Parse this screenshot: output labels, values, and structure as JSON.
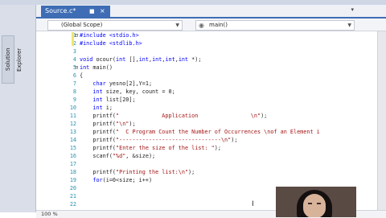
{
  "tab": {
    "title": "Source.c*"
  },
  "side_panel": {
    "label": "Solution Explorer"
  },
  "nav": {
    "scope": "(Global Scope)",
    "function": "main()"
  },
  "code_lines": [
    {
      "n": "1",
      "parts": [
        {
          "t": "#include <stdio.h>",
          "c": "kw"
        }
      ]
    },
    {
      "n": "2",
      "parts": [
        {
          "t": "#include <stdlib.h>",
          "c": "kw"
        }
      ]
    },
    {
      "n": "3",
      "parts": []
    },
    {
      "n": "4",
      "parts": [
        {
          "t": "void",
          "c": "kw"
        },
        {
          "t": " ocour(",
          "c": ""
        },
        {
          "t": "int",
          "c": "kw"
        },
        {
          "t": " [],",
          "c": ""
        },
        {
          "t": "int",
          "c": "kw"
        },
        {
          "t": ",",
          "c": ""
        },
        {
          "t": "int",
          "c": "kw"
        },
        {
          "t": ",",
          "c": ""
        },
        {
          "t": "int",
          "c": "kw"
        },
        {
          "t": ",",
          "c": ""
        },
        {
          "t": "int",
          "c": "kw"
        },
        {
          "t": " *);",
          "c": ""
        }
      ]
    },
    {
      "n": "5",
      "parts": [
        {
          "t": "int",
          "c": "kw"
        },
        {
          "t": " main()",
          "c": ""
        }
      ]
    },
    {
      "n": "6",
      "parts": [
        {
          "t": "{",
          "c": ""
        }
      ]
    },
    {
      "n": "7",
      "parts": [
        {
          "t": "    ",
          "c": ""
        },
        {
          "t": "char",
          "c": "kw"
        },
        {
          "t": " yesno[2],Y=1;",
          "c": ""
        }
      ]
    },
    {
      "n": "8",
      "parts": [
        {
          "t": "    ",
          "c": ""
        },
        {
          "t": "int",
          "c": "kw"
        },
        {
          "t": " size, key, count = 0;",
          "c": ""
        }
      ]
    },
    {
      "n": "9",
      "parts": [
        {
          "t": "    ",
          "c": ""
        },
        {
          "t": "int",
          "c": "kw"
        },
        {
          "t": " list[20];",
          "c": ""
        }
      ]
    },
    {
      "n": "10",
      "parts": [
        {
          "t": "    ",
          "c": ""
        },
        {
          "t": "int",
          "c": "kw"
        },
        {
          "t": " i;",
          "c": ""
        }
      ]
    },
    {
      "n": "11",
      "parts": [
        {
          "t": "    printf(",
          "c": ""
        },
        {
          "t": "\"             Application                \\n\"",
          "c": "str"
        },
        {
          "t": ");",
          "c": ""
        }
      ]
    },
    {
      "n": "12",
      "parts": [
        {
          "t": "    printf(",
          "c": ""
        },
        {
          "t": "\"\\n\"",
          "c": "str"
        },
        {
          "t": ");",
          "c": ""
        }
      ]
    },
    {
      "n": "13",
      "parts": [
        {
          "t": "    printf(",
          "c": ""
        },
        {
          "t": "\"  C Program Count the Number of Occurrences \\nof an Element i",
          "c": "str"
        }
      ]
    },
    {
      "n": "14",
      "parts": [
        {
          "t": "    printf(",
          "c": ""
        },
        {
          "t": "\"-------------------------------\\n\"",
          "c": "str"
        },
        {
          "t": ");",
          "c": ""
        }
      ]
    },
    {
      "n": "15",
      "parts": [
        {
          "t": "    printf(",
          "c": ""
        },
        {
          "t": "\"Enter the size of the list: \"",
          "c": "str"
        },
        {
          "t": ");",
          "c": ""
        }
      ]
    },
    {
      "n": "16",
      "parts": [
        {
          "t": "    scanf(",
          "c": ""
        },
        {
          "t": "\"%d\"",
          "c": "str"
        },
        {
          "t": ", &size);",
          "c": ""
        }
      ]
    },
    {
      "n": "17",
      "parts": []
    },
    {
      "n": "18",
      "parts": [
        {
          "t": "    printf(",
          "c": ""
        },
        {
          "t": "\"Printing the list:\\n\"",
          "c": "str"
        },
        {
          "t": ");",
          "c": ""
        }
      ]
    },
    {
      "n": "19",
      "parts": [
        {
          "t": "    ",
          "c": ""
        },
        {
          "t": "for",
          "c": "kw"
        },
        {
          "t": "(i=0<size; i++)",
          "c": ""
        }
      ]
    },
    {
      "n": "20",
      "parts": []
    },
    {
      "n": "21",
      "parts": []
    },
    {
      "n": "22",
      "parts": []
    }
  ],
  "status": {
    "zoom": "100 %"
  },
  "colors": {
    "accent": "#3e6db5",
    "keyword": "#0000ff",
    "string": "#a31515",
    "line_number": "#2b91af"
  }
}
